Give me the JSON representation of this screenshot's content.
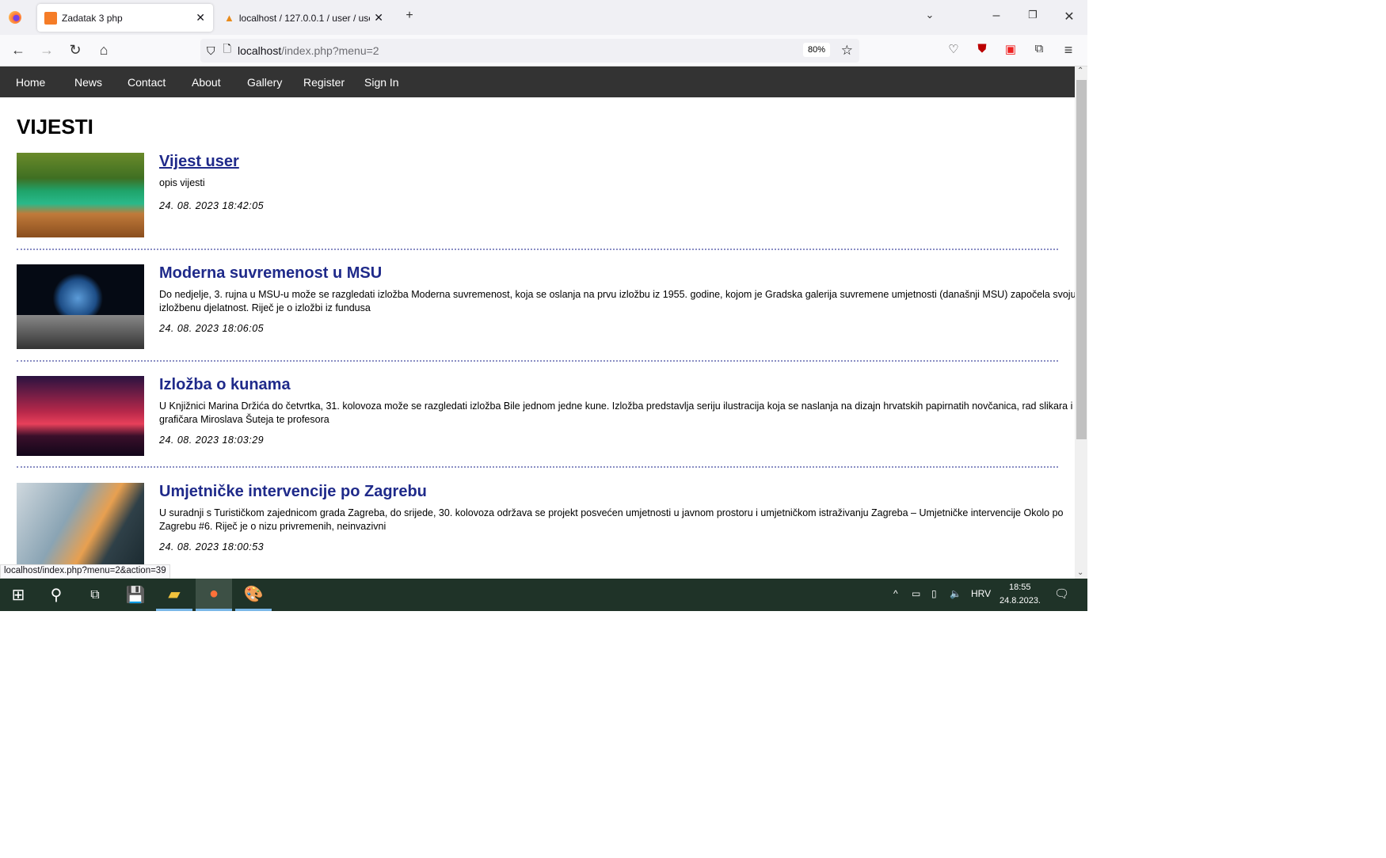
{
  "browser": {
    "tabs": [
      {
        "title": "Zadatak 3 php",
        "active": true
      },
      {
        "title": "localhost / 127.0.0.1 / user / use"
      }
    ],
    "url_host": "localhost",
    "url_path": "/index.php?menu=2",
    "zoom": "80%",
    "status_url": "localhost/index.php?menu=2&action=39"
  },
  "site": {
    "nav": [
      "Home",
      "News",
      "Contact",
      "About",
      "Gallery",
      "Register",
      "Sign In"
    ],
    "heading": "VIJESTI",
    "news": [
      {
        "title": "Vijest user",
        "desc": "opis vijesti",
        "date": "24. 08. 2023 18:42:05"
      },
      {
        "title": "Moderna suvremenost u MSU",
        "desc": "Do nedjelje, 3. rujna u MSU-u može se razgledati izložba Moderna suvremenost, koja se oslanja na prvu izložbu iz 1955. godine, kojom je Gradska galerija suvremene umjetnosti (današnji MSU) započela svoju izložbenu djelatnost. Riječ je o izložbi iz fundusa",
        "date": "24. 08. 2023 18:06:05"
      },
      {
        "title": "Izložba o kunama",
        "desc": "U Knjižnici Marina Držića do četvrtka, 31. kolovoza može se razgledati izložba Bile jednom jedne kune. Izložba predstavlja seriju ilustracija koja se naslanja na dizajn hrvatskih papirnatih novčanica, rad slikara i grafičara Miroslava Šuteja te profesora",
        "date": "24. 08. 2023 18:03:29"
      },
      {
        "title": "Umjetničke intervencije po Zagrebu",
        "desc": "U suradnji s Turističkom zajednicom grada Zagreba, do srijede, 30. kolovoza održava se projekt posvećen umjetnosti u javnom prostoru i umjetničkom istraživanju Zagreba – Umjetničke intervencije Okolo po Zagrebu #6. Riječ je o nizu privremenih, neinvazivni",
        "date": "24. 08. 2023 18:00:53"
      }
    ]
  },
  "taskbar": {
    "lang": "HRV",
    "time": "18:55",
    "date": "24.8.2023."
  }
}
